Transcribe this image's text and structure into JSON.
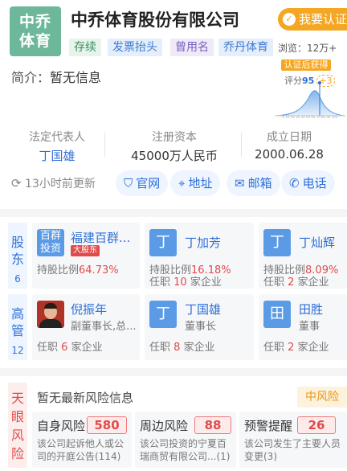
{
  "company": {
    "logo_text_line1": "中乔",
    "logo_text_line2": "体育",
    "name": "中乔体育股份有限公司",
    "claim_label": "我要认证",
    "tags": [
      "存续",
      "发票抬头",
      "曾用名",
      "乔丹体育"
    ],
    "views": "浏览：12万+",
    "intro_label": "简介：",
    "intro_value": "暂无信息"
  },
  "score": {
    "caption": "认证后获得",
    "label": "评分",
    "value": "95",
    "plus": "+3",
    "axis": "0 10 20 30 40 50 60 70 80 90 100"
  },
  "stats": [
    {
      "label": "法定代表人",
      "value": "丁国雄"
    },
    {
      "label": "注册资本",
      "value": "45000万人民币"
    },
    {
      "label": "成立日期",
      "value": "2000.06.28"
    }
  ],
  "update_text": "13小时前更新",
  "quick_links": [
    {
      "icon": "shield-check-icon",
      "glyph": "⛉",
      "label": "官网"
    },
    {
      "icon": "location-pin-icon",
      "glyph": "⌖",
      "label": "地址"
    },
    {
      "icon": "envelope-icon",
      "glyph": "✉",
      "label": "邮箱"
    },
    {
      "icon": "phone-icon",
      "glyph": "✆",
      "label": "电话"
    }
  ],
  "shareholders": {
    "side_label_1": "股",
    "side_label_2": "东",
    "count": "6",
    "items": [
      {
        "avatar_line1": "百群",
        "avatar_line2": "投资",
        "name": "福建百群...",
        "badge": "大股东",
        "prefix": "持股比例",
        "ratio": "64.73%"
      },
      {
        "avatar": "丁",
        "name": "丁加芳",
        "prefix": "持股比例",
        "ratio": "16.18%",
        "job_prefix": "任职",
        "jobs": "10",
        "job_suffix": "家企业"
      },
      {
        "avatar": "丁",
        "name": "丁灿辉",
        "prefix": "持股比例",
        "ratio": "8.09%",
        "job_prefix": "任职",
        "jobs": "2",
        "job_suffix": "家企业"
      }
    ]
  },
  "executives": {
    "side_label_1": "高",
    "side_label_2": "管",
    "count": "12",
    "items": [
      {
        "name": "倪振年",
        "title": "副董事长,总...",
        "job_prefix": "任职",
        "jobs": "6",
        "job_suffix": "家企业"
      },
      {
        "avatar": "丁",
        "name": "丁国雄",
        "title": "董事长",
        "job_prefix": "任职",
        "jobs": "8",
        "job_suffix": "家企业"
      },
      {
        "avatar": "田",
        "name": "田胜",
        "title": "董事",
        "job_prefix": "任职",
        "jobs": "2",
        "job_suffix": "家企业"
      }
    ]
  },
  "risk": {
    "side_label": [
      "天",
      "眼",
      "风",
      "险"
    ],
    "title": "暂无最新风险信息",
    "level": "中风险",
    "cards": [
      {
        "name": "自身风险",
        "num": "580",
        "desc": "该公司起诉他人或公司的开庭公告(114)"
      },
      {
        "name": "周边风险",
        "num": "88",
        "desc": "该公司投资的宁夏百瑞商贸有限公司...(1)"
      },
      {
        "name": "预警提醒",
        "num": "26",
        "desc": "该公司发生了主要人员变更(3)"
      }
    ]
  },
  "colors": {
    "brand": "#6db89a",
    "link": "#2f6fd6",
    "risk": "#e14b4b",
    "warn": "#f5a623"
  }
}
